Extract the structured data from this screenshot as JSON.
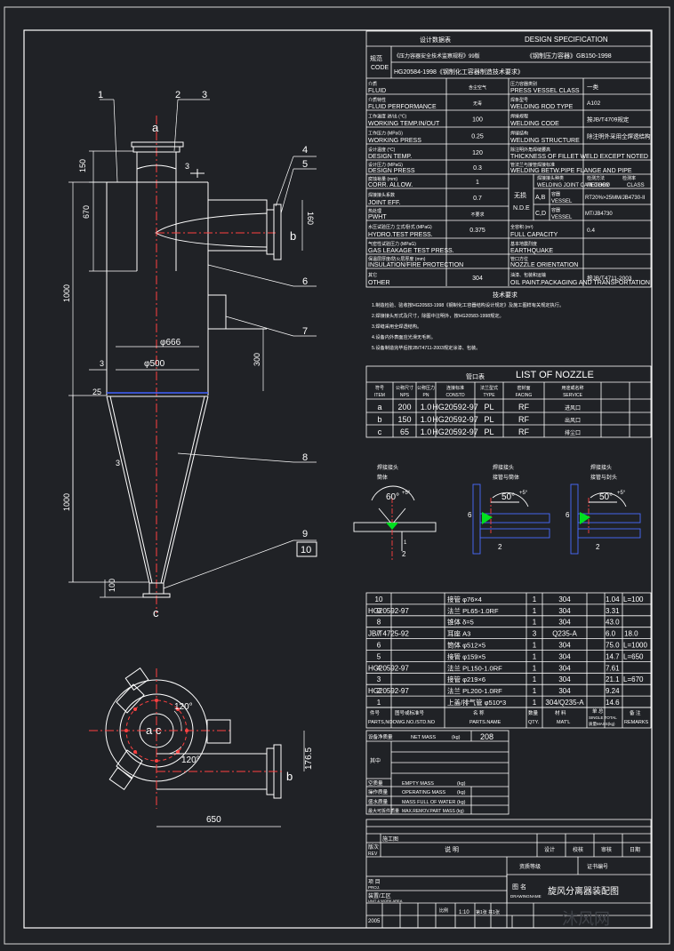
{
  "header": {
    "cn_spec": "设计数据表",
    "design_spec": "DESIGN SPECIFICATION",
    "code_label": "规范",
    "code_en": "CODE",
    "code_line1_cn": "《压力容器安全技术监察规程》99版",
    "code_line1_gb": "《钢制压力容器》GB150-1998",
    "code_line2": "HG20584-1998《钢制化工容器制造技术要求》"
  },
  "spec_rows": [
    {
      "lcn": "介质",
      "len": "FLUID",
      "lv": "含尘空气",
      "rcn": "压力容器类别",
      "ren": "PRESS VESSEL CLASS",
      "rv": "一类"
    },
    {
      "lcn": "介质特性",
      "len": "FLUID PERFORMANCE",
      "lv": "无毒",
      "rcn": "焊条型号",
      "ren": "WELDING ROD TYPE",
      "rv": "A102"
    },
    {
      "lcn": "工作温度 进/出 (°C)",
      "len": "WORKING TEMP.IN/OUT",
      "lv": "100",
      "rcn": "焊接规程",
      "ren": "WELDING CODE",
      "rv": "按JB/T4709规定"
    },
    {
      "lcn": "工作压力 (MPaG)",
      "len": "WORKING PRESS",
      "lv": "0.25",
      "rcn": "焊缝结构",
      "ren": "WELDING STRUCTURE",
      "rv": "除注明外采用全焊透结构"
    },
    {
      "lcn": "设计温度 (°C)",
      "len": "DESIGN TEMP.",
      "lv": "120",
      "rcn": "除注明外角焊缝腰高",
      "ren": "THICKNESS OF FILLET WELD EXCEPT NOTED",
      "rv": ""
    },
    {
      "lcn": "设计压力 (MPaG)",
      "len": "DESIGN PRESS",
      "lv": "0.3",
      "rcn": "管法兰与接管焊接标准",
      "ren": "WELDING BETW.PIPE FLANGE AND PIPE",
      "rv": ""
    },
    {
      "lcn": "腐蚀裕量 (mm)",
      "len": "CORR. ALLOW.",
      "lv": "1",
      "rcn": "",
      "ren": "",
      "rv": ""
    },
    {
      "lcn": "焊接接头系数",
      "len": "JOINT EFF.",
      "lv": "0.7",
      "rcn": "",
      "ren": "",
      "rv": ""
    },
    {
      "lcn": "热处理",
      "len": "PWHT",
      "lv": "不要求",
      "rcn": "",
      "ren": "",
      "rv": ""
    },
    {
      "lcn": "水压试验压力 立式/卧式 (MPaG)",
      "len": "HYDRO.TEST PRESS.",
      "lv": "0.375",
      "rcn": "全容积 (m³)",
      "ren": "FULL CAPACITY",
      "rv": "0.4"
    },
    {
      "lcn": "气密性试验压力 (MPaG)",
      "len": "GAS LEAKAGE TEST PRESS.",
      "lv": "",
      "rcn": "基本地震烈度",
      "ren": "EARTHQUAKE",
      "rv": ""
    },
    {
      "lcn": "保温层厚度/防火层厚度 (mm)",
      "len": "INSULATION/FIRE PROTECTION",
      "lv": "",
      "rcn": "管口方位",
      "ren": "NOZZLE ORIENTATION",
      "rv": ""
    },
    {
      "lcn": "其它",
      "len": "OTHER",
      "lv": "304",
      "rcn": "油漆、包装和运输",
      "ren": "OIL PAINT.PACKAGING AND TRANSPORTATION",
      "rv": "按JB/T4711-2003"
    }
  ],
  "nde": {
    "label_cn": "无损",
    "label_en": "N.D.E",
    "joint_cn": "焊接接头种类",
    "joint_en": "WELDING JOINT CATEGORY",
    "method_cn": "检测方法",
    "method_en": "METHOD",
    "class_cn": "检测率",
    "class_en": "CLASS",
    "vessel_cn": "容器",
    "vessel_en": "VESSEL",
    "a_label": "A,B",
    "c_label": "C,D",
    "a_value": "RT20%>25MM/JB4730-II",
    "c_value": "MT/JB4730"
  },
  "tech_req": {
    "title": "技术要求",
    "items": [
      "1.制造检验、验收按HG20583-1998《钢制化工容器结构设计规定》及施工图样有关规定执行。",
      "2.焊接接头形式及尺寸，除图中注明外，按HG20583-1998规定。",
      "3.焊缝采用全焊透结构。",
      "4.设备内外表面应光滑无毛刺。",
      "5.设备制造完毕后按JB/T4711-2003规定涂漆、包装。"
    ]
  },
  "nozzle_table": {
    "title_cn": "管口表",
    "title": "LIST OF NOZZLE",
    "headers_cn": [
      "符号",
      "公称尺寸",
      "公称压力",
      "连接标准",
      "法兰型式",
      "密封面",
      "用途或名称",
      "",
      ""
    ],
    "headers_en": [
      "ITEM",
      "NPS",
      "PN",
      "CONSTD",
      "TYPE",
      "FACING",
      "SERVICE",
      "",
      ""
    ],
    "rows": [
      [
        "a",
        "200",
        "1.0",
        "HG20592-97",
        "PL",
        "RF",
        "进风口",
        "",
        ""
      ],
      [
        "b",
        "150",
        "1.0",
        "HG20592-97",
        "PL",
        "RF",
        "出风口",
        "",
        ""
      ],
      [
        "c",
        "65",
        "1.0",
        "HG20592-97",
        "PL",
        "RF",
        "排尘口",
        "",
        ""
      ]
    ]
  },
  "weld_details": [
    {
      "title": "焊接接头",
      "sub": "筒体",
      "angle": "60°",
      "tol": "+5°",
      "gap": "2",
      "root": "1"
    },
    {
      "title": "焊接接头",
      "sub": "接管与筒体",
      "angle": "50°",
      "tol": "+5°",
      "gap": "2",
      "root": "6"
    },
    {
      "title": "焊接接头",
      "sub": "接管与封头",
      "angle": "50°",
      "tol": "+5°",
      "gap": "2",
      "root": "6"
    }
  ],
  "parts": [
    {
      "no": "10",
      "dwg": "",
      "name": "接管 φ76×4",
      "qty": "1",
      "matl": "304",
      "single": "1.04",
      "total": "",
      "remark": "L=100"
    },
    {
      "no": "9",
      "dwg": "HG20592-97",
      "name": "法兰 PL65-1.0RF",
      "qty": "1",
      "matl": "304",
      "single": "3.31",
      "total": "",
      "remark": ""
    },
    {
      "no": "8",
      "dwg": "",
      "name": "锥体 δ=5",
      "qty": "1",
      "matl": "304",
      "single": "43.0",
      "total": "",
      "remark": ""
    },
    {
      "no": "7",
      "dwg": "JB/T4725-92",
      "name": "耳座 A3",
      "qty": "3",
      "matl": "Q235-A",
      "single": "6.0",
      "total": "18.0",
      "remark": ""
    },
    {
      "no": "6",
      "dwg": "",
      "name": "筒体 φ512×5",
      "qty": "1",
      "matl": "304",
      "single": "75.0",
      "total": "",
      "remark": "L=1000"
    },
    {
      "no": "5",
      "dwg": "",
      "name": "接管 φ159×5",
      "qty": "1",
      "matl": "304",
      "single": "14.7",
      "total": "",
      "remark": "L=650"
    },
    {
      "no": "4",
      "dwg": "HG20592-97",
      "name": "法兰 PL150-1.0RF",
      "qty": "1",
      "matl": "304",
      "single": "7.61",
      "total": "",
      "remark": ""
    },
    {
      "no": "3",
      "dwg": "",
      "name": "接管 φ219×6",
      "qty": "1",
      "matl": "304",
      "single": "21.1",
      "total": "",
      "remark": "L=670"
    },
    {
      "no": "2",
      "dwg": "HG20592-97",
      "name": "法兰 PL200-1.0RF",
      "qty": "1",
      "matl": "304",
      "single": "9.24",
      "total": "",
      "remark": ""
    },
    {
      "no": "1",
      "dwg": "",
      "name": "上盖/排气管 φ510*3",
      "qty": "1",
      "matl": "304/Q235-A",
      "single": "14.6",
      "total": "",
      "remark": ""
    }
  ],
  "parts_header": {
    "no_cn": "件号",
    "no_en": "PARTS,NO",
    "dwg_cn": "图号或标准号",
    "dwg_en": "DWG.NO./STD.NO",
    "name_cn": "名 称",
    "name_en": "PARTS.NAME",
    "qty_cn": "数量",
    "qty_en": "QTY.",
    "matl_cn": "材 料",
    "matl_en": "MAT'L",
    "mass_cn": "单 总",
    "mass_en1": "SINGLE TOTAL",
    "mass_en2": "质量MASS(kg)",
    "rem_cn": "备 注",
    "rem_en": "REMARKS"
  },
  "mass_table": {
    "equip_cn": "设备净质量",
    "net_en": "NET MASS",
    "unit": "(kg)",
    "net_value": "208",
    "among_cn": "其中",
    "empty_cn": "空质量",
    "empty_en": "EMPTY MASS",
    "oper_cn": "操作质量",
    "oper_en": "OPERATING MASS",
    "water_cn": "盛水质量",
    "water_en": "MASS FULL OF WATER",
    "maxm_cn": "最大可拆件质量",
    "maxm_en": "MAX.REMOV.PART MASS (kg)"
  },
  "title_block": {
    "blank_cn": "施工图",
    "rev_cn": "版次",
    "rev_en": "REV",
    "desc_cn": "说 明",
    "cols": [
      "设计",
      "校核",
      "审核",
      "日期"
    ],
    "proj_cn": "项 目",
    "proj_en": "PROJ.",
    "sub_cn": "装置/工区",
    "sub_en": "UNIT & WORK AREA",
    "inst_cn": "资质等级",
    "inst2_cn": "证书编号",
    "drawing_cn": "图 名",
    "drawing_en": "DRAWINGNAME",
    "drawing_name": "旋风分离器装配图",
    "scale_label": "比例",
    "scale": "1:10",
    "sheet": "第1张 共1张",
    "date_label": "2005",
    "bottom_cells": [
      "比例",
      "第 张",
      "共 张",
      "图号"
    ]
  },
  "drawing": {
    "labels": [
      "1",
      "2",
      "3",
      "4",
      "5",
      "6",
      "7",
      "8",
      "9",
      "10"
    ],
    "nozzle_a": "a",
    "nozzle_b": "b",
    "nozzle_c": "c",
    "nozzle_ac": "a c",
    "dims": {
      "d150": "150",
      "d670": "670",
      "d1000a": "1000",
      "d1000b": "1000",
      "d100": "100",
      "d160": "160",
      "d300": "300",
      "d666": "φ666",
      "d500": "φ500",
      "d3a": "3",
      "d3b": "3",
      "d3c": "3",
      "d25": "25",
      "d120a": "120°",
      "d120b": "120°",
      "d1765": "176.5",
      "d650": "650"
    }
  },
  "watermark": "沐风网"
}
